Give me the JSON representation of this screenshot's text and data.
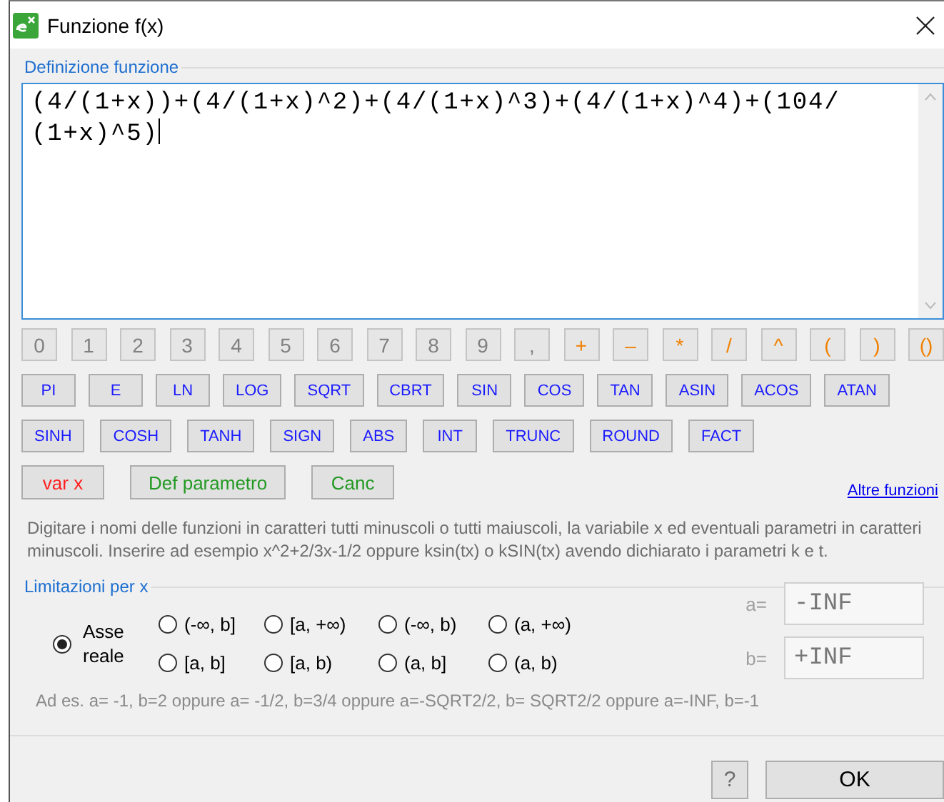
{
  "window": {
    "title": "Funzione f(x)"
  },
  "definition": {
    "label": "Definizione funzione",
    "value": "(4/(1+x))+(4/(1+x)^2)+(4/(1+x)^3)+(4/(1+x)^4)+(104/(1+x)^5)"
  },
  "keypad": [
    [
      {
        "label": "0",
        "kind": "digit"
      },
      {
        "label": "1",
        "kind": "digit"
      },
      {
        "label": "2",
        "kind": "digit"
      },
      {
        "label": "3",
        "kind": "digit"
      },
      {
        "label": "4",
        "kind": "digit"
      },
      {
        "label": "5",
        "kind": "digit"
      },
      {
        "label": "6",
        "kind": "digit"
      },
      {
        "label": "7",
        "kind": "digit"
      },
      {
        "label": "8",
        "kind": "digit"
      },
      {
        "label": "9",
        "kind": "digit"
      },
      {
        "label": ",",
        "kind": "digit"
      },
      {
        "label": "+",
        "kind": "operator"
      },
      {
        "label": "–",
        "kind": "operator"
      },
      {
        "label": "*",
        "kind": "operator"
      },
      {
        "label": "/",
        "kind": "operator"
      },
      {
        "label": "^",
        "kind": "operator"
      },
      {
        "label": "(",
        "kind": "operator"
      },
      {
        "label": ")",
        "kind": "operator"
      },
      {
        "label": "()",
        "kind": "operator"
      }
    ],
    [
      {
        "label": "PI",
        "kind": "function"
      },
      {
        "label": "E",
        "kind": "function"
      },
      {
        "label": "LN",
        "kind": "function"
      },
      {
        "label": "LOG",
        "kind": "function"
      },
      {
        "label": "SQRT",
        "kind": "function"
      },
      {
        "label": "CBRT",
        "kind": "function"
      },
      {
        "label": "SIN",
        "kind": "function"
      },
      {
        "label": "COS",
        "kind": "function"
      },
      {
        "label": "TAN",
        "kind": "function"
      },
      {
        "label": "ASIN",
        "kind": "function"
      },
      {
        "label": "ACOS",
        "kind": "function"
      },
      {
        "label": "ATAN",
        "kind": "function"
      }
    ],
    [
      {
        "label": "SINH",
        "kind": "function"
      },
      {
        "label": "COSH",
        "kind": "function"
      },
      {
        "label": "TANH",
        "kind": "function"
      },
      {
        "label": "SIGN",
        "kind": "function"
      },
      {
        "label": "ABS",
        "kind": "function"
      },
      {
        "label": "INT",
        "kind": "function"
      },
      {
        "label": "TRUNC",
        "kind": "function"
      },
      {
        "label": "ROUND",
        "kind": "function"
      },
      {
        "label": "FACT",
        "kind": "function"
      }
    ],
    [
      {
        "label": "var x",
        "kind": "variable"
      },
      {
        "label": "Def parametro",
        "kind": "parameter"
      },
      {
        "label": "Canc",
        "kind": "parameter"
      }
    ]
  ],
  "more_link": "Altre funzioni",
  "help_text": "Digitare i nomi delle funzioni in caratteri tutti minuscoli o tutti maiuscoli, la variabile x ed eventuali parametri in caratteri minuscoli. Inserire ad esempio x^2+2/3x-1/2 oppure ksin(tx) o kSIN(tx) avendo dichiarato i parametri k e t.",
  "limits": {
    "label": "Limitazioni per x",
    "options": [
      {
        "label": "Asse reale",
        "selected": true
      },
      {
        "label": "(-∞, b]",
        "selected": false
      },
      {
        "label": "[a, +∞)",
        "selected": false
      },
      {
        "label": "(-∞, b)",
        "selected": false
      },
      {
        "label": "(a, +∞)",
        "selected": false
      },
      {
        "label": "[a, b]",
        "selected": false
      },
      {
        "label": "[a, b)",
        "selected": false
      },
      {
        "label": "(a, b]",
        "selected": false
      },
      {
        "label": "(a, b)",
        "selected": false
      }
    ],
    "a_label": "a=",
    "a_value": "-INF",
    "b_label": "b=",
    "b_value": "+INF",
    "example": "Ad es. a= -1, b=2 oppure a= -1/2, b=3/4 oppure a=-SQRT2/2, b= SQRT2/2 oppure a=-INF, b=-1"
  },
  "buttons": [
    {
      "label": "?",
      "kind": "help"
    },
    {
      "label": "OK",
      "kind": "ok"
    }
  ]
}
